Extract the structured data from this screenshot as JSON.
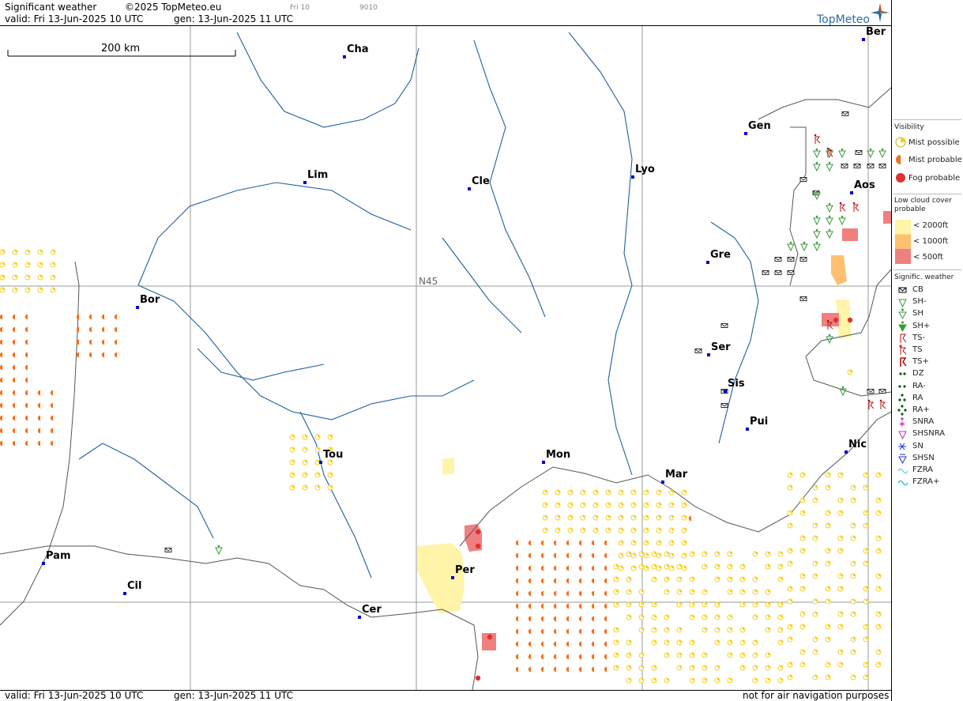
{
  "header": {
    "title": "Significant weather",
    "copyright": "©2025 TopMeteo.eu",
    "valid": "valid:  Fri  13-Jun-2025  10 UTC",
    "gen": "gen: 13-Jun-2025 11 UTC",
    "tag1": "Fri 10",
    "tag2": "9010",
    "logo": "TopMeteo"
  },
  "scale_label": "200 km",
  "grid_label": "N45",
  "cities": [
    {
      "name": "Cha"
    },
    {
      "name": "Lim"
    },
    {
      "name": "Cle"
    },
    {
      "name": "Lyo"
    },
    {
      "name": "Gen"
    },
    {
      "name": "Ber"
    },
    {
      "name": "Aos"
    },
    {
      "name": "Gre"
    },
    {
      "name": "Bor"
    },
    {
      "name": "Ser"
    },
    {
      "name": "Sis"
    },
    {
      "name": "Pui"
    },
    {
      "name": "Nic"
    },
    {
      "name": "Tou"
    },
    {
      "name": "Mon"
    },
    {
      "name": "Mar"
    },
    {
      "name": "Pam"
    },
    {
      "name": "Cil"
    },
    {
      "name": "Per"
    },
    {
      "name": "Cer"
    }
  ],
  "footer": {
    "valid": "valid:  Fri  13-Jun-2025  10 UTC",
    "gen": "gen: 13-Jun-2025 11 UTC",
    "note": "not for air navigation purposes"
  },
  "legend": {
    "visibility_title": "Visibility",
    "visibility": [
      "Mist possible",
      "Mist probable",
      "Fog probable"
    ],
    "lowcloud_title": "Low cloud cover probable",
    "lowcloud": [
      "< 2000ft",
      "< 1000ft",
      "<   500ft"
    ],
    "sigwx_title": "Signific. weather",
    "sigwx": [
      "CB",
      "SH-",
      "SH",
      "SH+",
      "TS-",
      "TS",
      "TS+",
      "DZ",
      "RA-",
      "RA",
      "RA+",
      "SNRA",
      "SHSNRA",
      "SN",
      "SHSN",
      "FZRA",
      "FZRA+"
    ]
  },
  "colors": {
    "mist_possible": "#f5d020",
    "mist_probable": "#f07020",
    "fog_probable": "#e03030",
    "cloud_2000": "#fff4a8",
    "cloud_1000": "#ffc070",
    "cloud_500": "#f08080",
    "city": "#0000cc",
    "river": "#2060a0",
    "shower": "#3a9a3a",
    "ts": "#b01010"
  }
}
